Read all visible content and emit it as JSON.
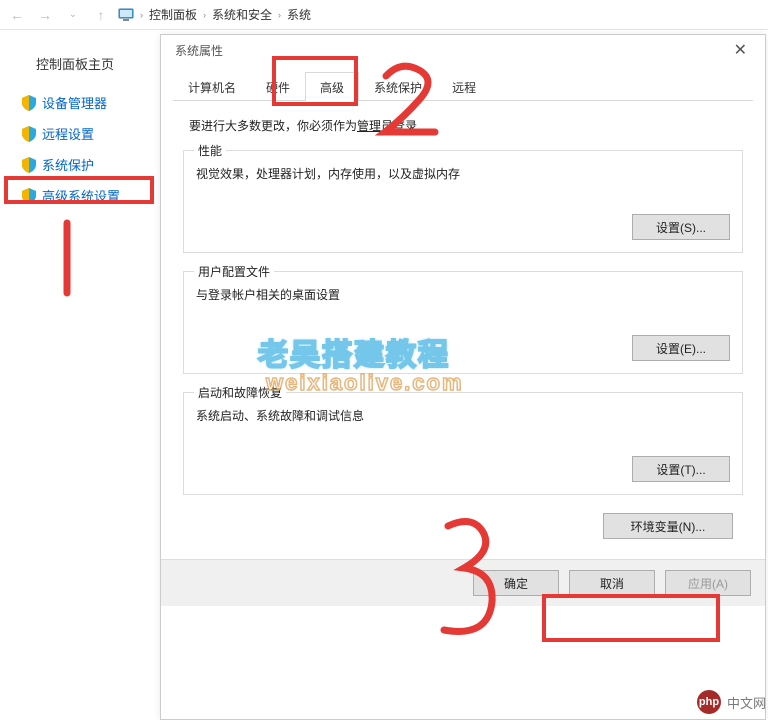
{
  "topbar": {
    "back": "←",
    "forward": "→",
    "up": "↑",
    "crumbs": [
      "控制面板",
      "系统和安全",
      "系统"
    ],
    "sep": "›"
  },
  "sidebar": {
    "title": "控制面板主页",
    "links": [
      "设备管理器",
      "远程设置",
      "系统保护",
      "高级系统设置"
    ]
  },
  "dialog": {
    "title": "系统属性",
    "close": "✕",
    "tabs": [
      "计算机名",
      "硬件",
      "高级",
      "系统保护",
      "远程"
    ],
    "activeTab": 2,
    "adminPrefix": "要进行大多数更改，你必须作为",
    "adminLink": "管理员登录",
    "groups": [
      {
        "label": "性能",
        "desc": "视觉效果，处理器计划，内存使用，以及虚拟内存",
        "button": "设置(S)..."
      },
      {
        "label": "用户配置文件",
        "desc": "与登录帐户相关的桌面设置",
        "button": "设置(E)..."
      },
      {
        "label": "启动和故障恢复",
        "desc": "系统启动、系统故障和调试信息",
        "button": "设置(T)..."
      }
    ],
    "envButton": "环境变量(N)...",
    "footer": {
      "ok": "确定",
      "cancel": "取消",
      "apply": "应用(A)"
    }
  },
  "watermark": {
    "line1": "老吴搭建教程",
    "line2": "weixiaolive.com"
  },
  "brand": {
    "logo": "php",
    "text": "中文网"
  },
  "annotations": {
    "one": "1",
    "two": "2",
    "three": "3"
  },
  "colors": {
    "annotation": "#e53935",
    "link": "#0066cc",
    "shield": "#2aa8e0"
  }
}
